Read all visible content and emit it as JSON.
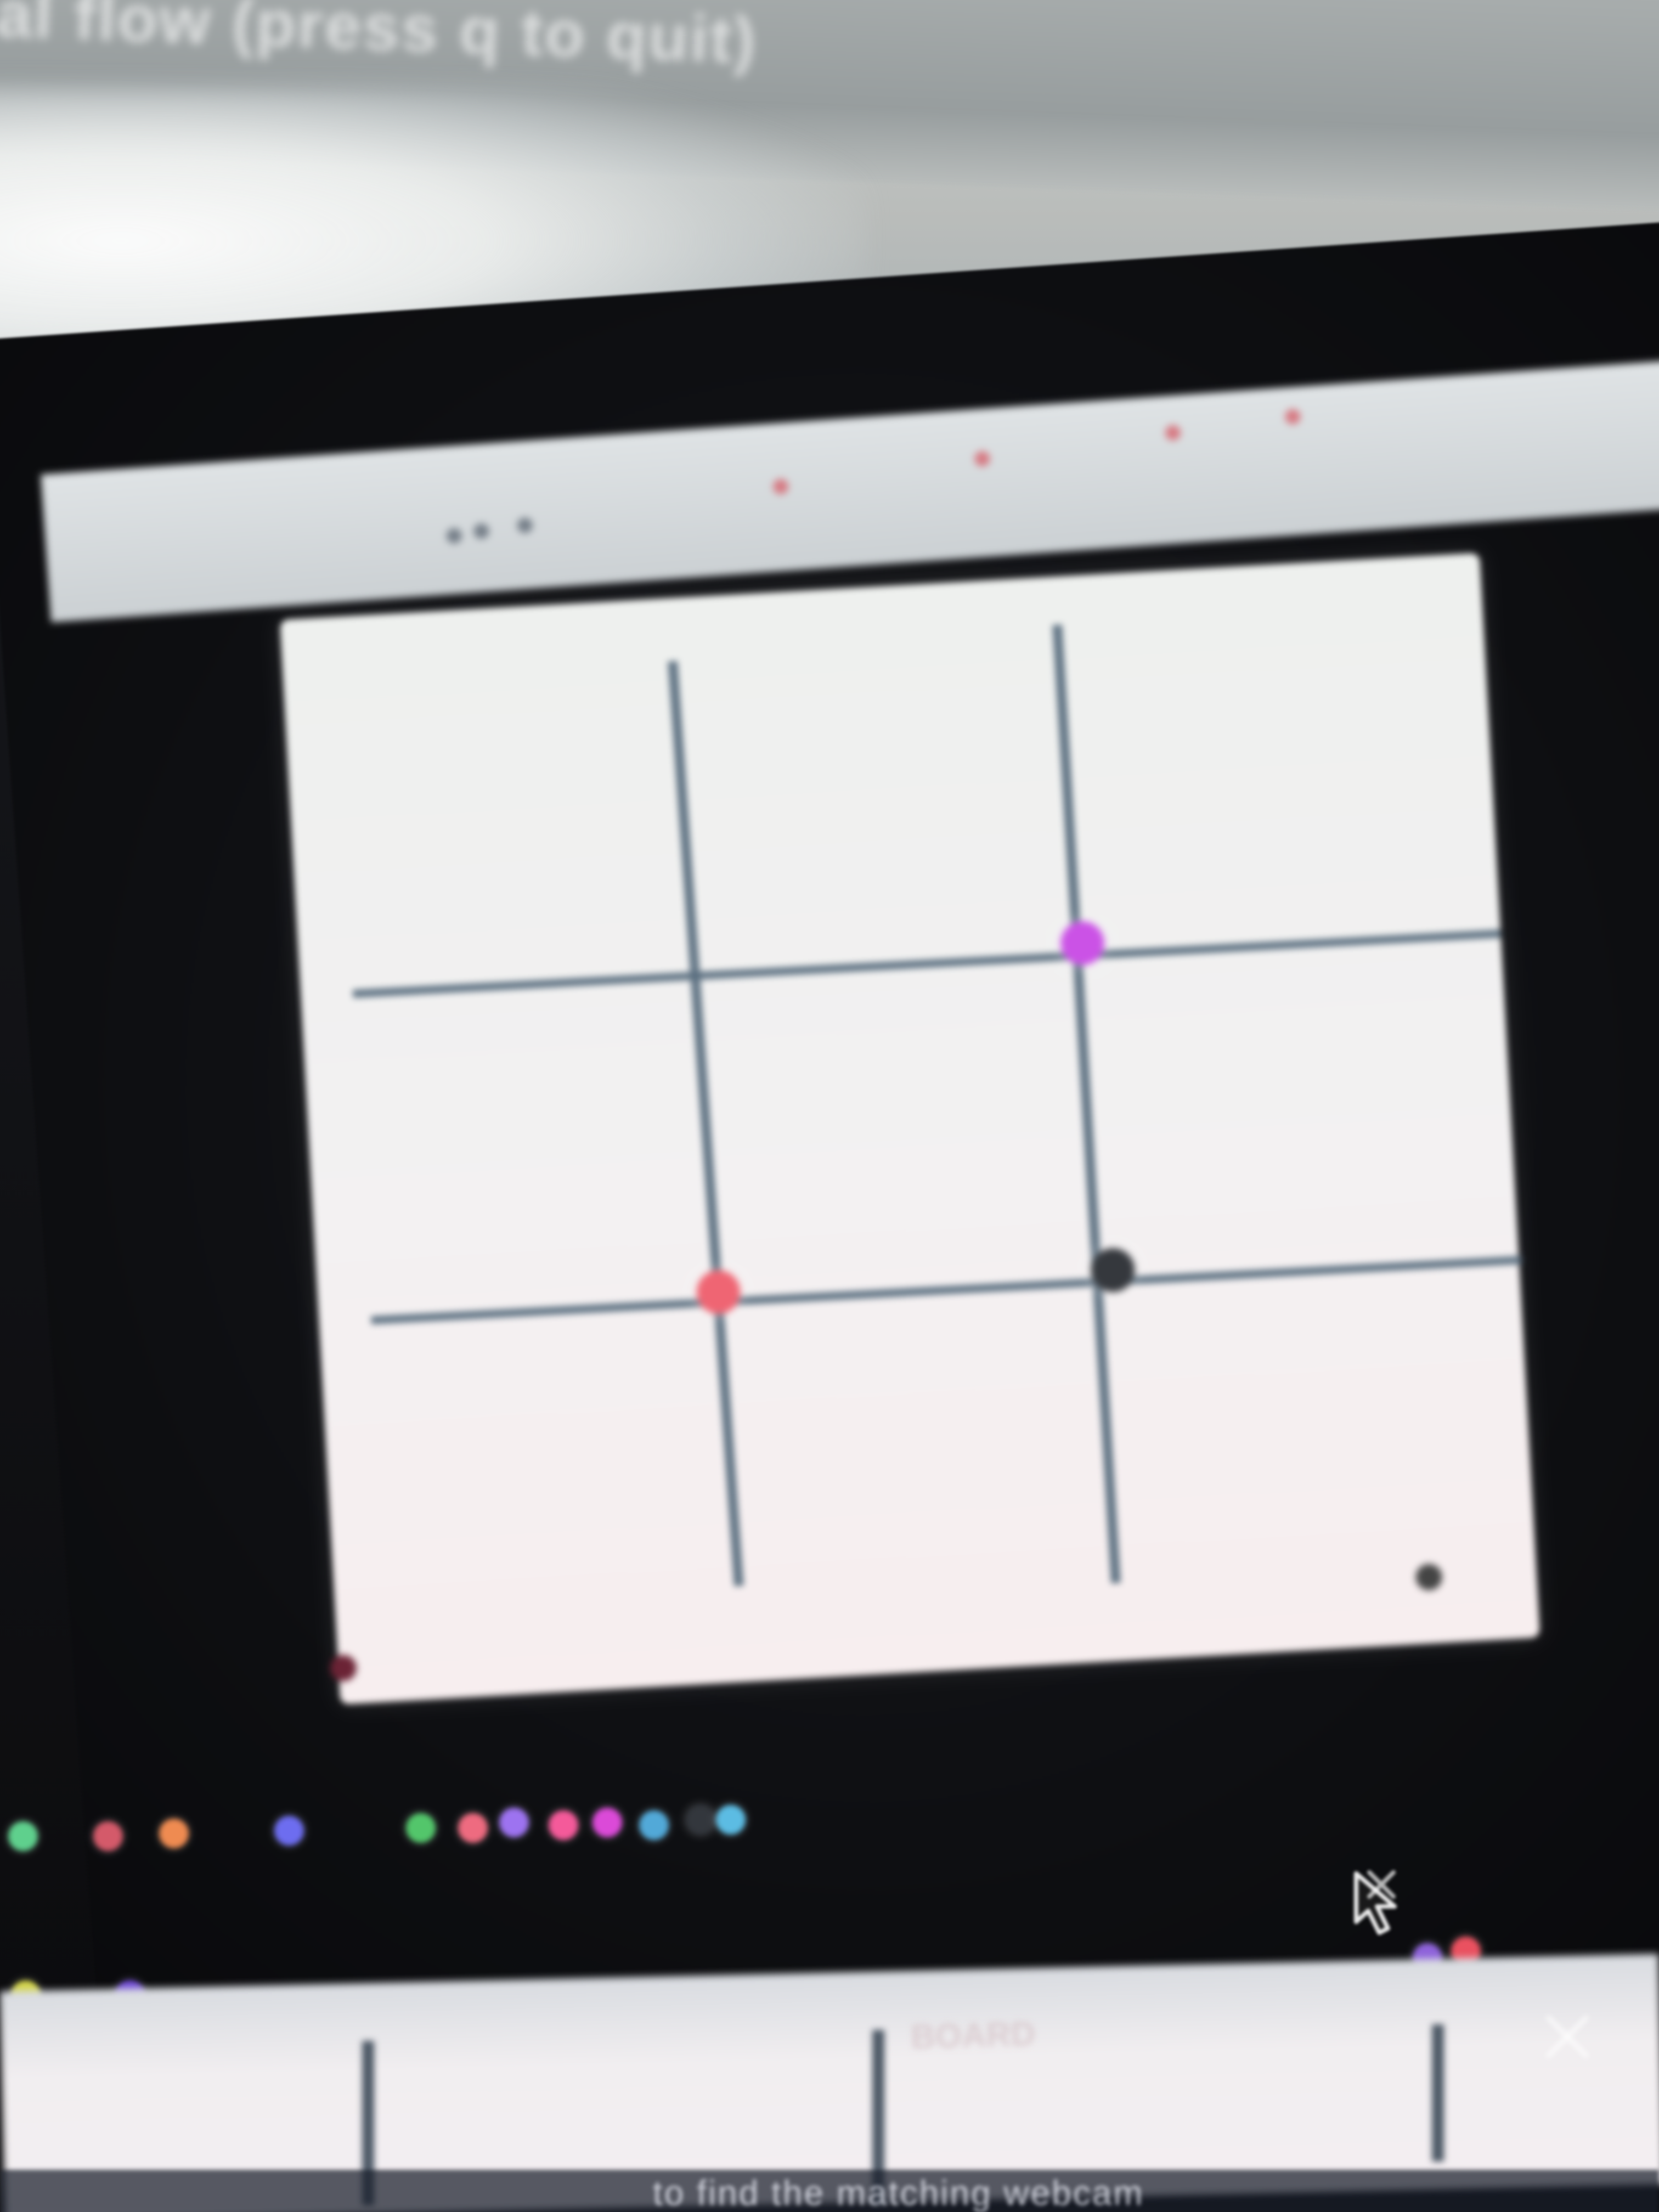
{
  "window": {
    "title": "cal flow (press q to quit)"
  },
  "bottom_subtitle": "to find the matching webcam",
  "bottom_caption": "BOARD",
  "colors": {
    "grid_line": "#5b6f80",
    "pink_node": "#cb52e6",
    "red_node": "#ef6573",
    "dark_node": "#35383d",
    "canvas": "#f3f1f2"
  },
  "icons": {
    "cursor": "mouse-pointer-icon",
    "close": "close-icon"
  }
}
